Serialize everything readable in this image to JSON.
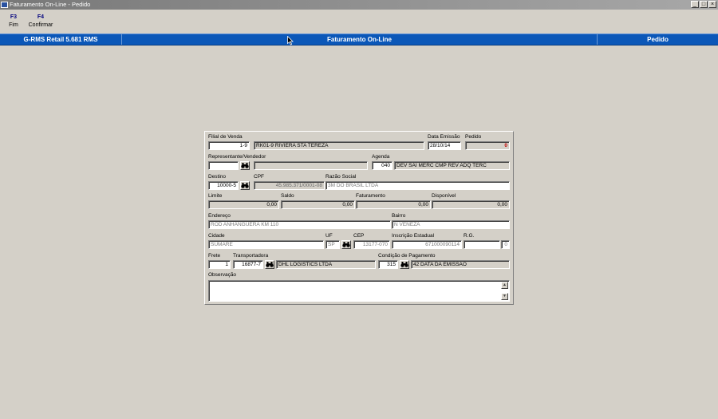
{
  "window": {
    "title": "Faturamento On-Line - Pedido",
    "controls": [
      "_",
      "□",
      "×"
    ]
  },
  "toolbar": {
    "keys": [
      {
        "code": "F3",
        "label": "Fim"
      },
      {
        "code": "F4",
        "label": "Confirmar"
      }
    ]
  },
  "header": {
    "left": "G-RMS Retail 5.681 RMS",
    "center": "Faturamento On-Line",
    "right": "Pedido"
  },
  "icons": {
    "search": "binoculars-icon",
    "scroll_up": "▲",
    "scroll_down": "▼",
    "binoculars_glyph": "👓"
  },
  "form": {
    "filial_label": "Filial de Venda",
    "filial_code": "1-9",
    "filial_name": "RK01-9 RIVIERA STA TEREZA",
    "data_emissao_label": "Data Emissão",
    "data_emissao": "28/10/14",
    "pedido_label": "Pedido",
    "pedido": "0",
    "representante_label": "Representante/Vendedor",
    "representante_code": "",
    "representante_name": "",
    "agenda_label": "Agenda",
    "agenda_code": "040",
    "agenda_desc": "DEV SAI MERC CMP REV ADQ TERC",
    "destino_label": "Destino",
    "destino": "10000-5",
    "cpf_label": "CPF",
    "cpf": "45.985.371/0001-08",
    "razao_label": "Razão Social",
    "razao": "3M DO BRASIL LTDA",
    "limite_label": "Limite",
    "limite": "0,00",
    "saldo_label": "Saldo",
    "saldo": "0,00",
    "faturamento_label": "Faturamento",
    "faturamento": "0,00",
    "disponivel_label": "Disponível",
    "disponivel": "0,00",
    "endereco_label": "Endereço",
    "endereco": "ROD ANHANGUERA KM 110",
    "bairro_label": "Bairro",
    "bairro": "N VENEZA",
    "cidade_label": "Cidade",
    "cidade": "SUMARE",
    "uf_label": "UF",
    "uf": "SP",
    "cep_label": "CEP",
    "cep": "13177-070",
    "ie_label": "Inscrição Estadual",
    "ie": "671000090114",
    "rg_label": "R.G.",
    "rg": "",
    "rg_extra": "0",
    "frete_label": "Frete",
    "frete": "1",
    "transportadora_label": "Transportadora",
    "transportadora_code": "16877-7",
    "transportadora_name": "DHL LOGISTICS LTDA",
    "condicao_label": "Condição de Pagamento",
    "condicao_code": "315",
    "condicao_desc": "42 DATA DA EMISSAO",
    "observacao_label": "Observação",
    "observacao": ""
  },
  "colors": {
    "header_blue": "#0b57b8",
    "window_bg": "#d4d0c8",
    "key_blue": "#00007e",
    "pedido_red": "#c00000"
  }
}
